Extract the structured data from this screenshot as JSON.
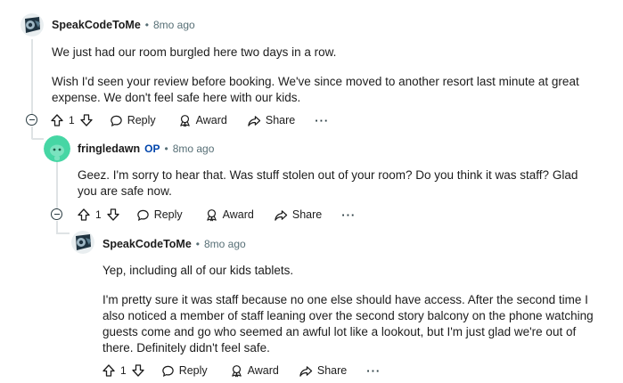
{
  "comments": [
    {
      "author": "SpeakCodeToMe",
      "separator": "•",
      "time": "8mo ago",
      "paragraphs": [
        "We just had our room burgled here two days in a row.",
        "Wish I'd seen your review before booking. We've since moved to another resort last minute at great expense. We don't feel safe here with our kids."
      ],
      "votes": "1",
      "reply_label": "Reply",
      "award_label": "Award",
      "share_label": "Share",
      "more_label": "···"
    },
    {
      "author": "fringledawn",
      "op_badge": "OP",
      "separator": "•",
      "time": "8mo ago",
      "paragraphs": [
        "Geez. I'm sorry to hear that. Was stuff stolen out of your room? Do you think it was staff? Glad you are safe now."
      ],
      "votes": "1",
      "reply_label": "Reply",
      "award_label": "Award",
      "share_label": "Share",
      "more_label": "···"
    },
    {
      "author": "SpeakCodeToMe",
      "separator": "•",
      "time": "8mo ago",
      "paragraphs": [
        "Yep, including all of our kids tablets.",
        "I'm pretty sure it was staff because no one else should have access. After the second time I also noticed a member of staff leaning over the second story balcony on the phone watching guests come and go who seemed an awful lot like a lookout, but I'm just glad we're out of there. Definitely didn't feel safe."
      ],
      "votes": "1",
      "reply_label": "Reply",
      "award_label": "Award",
      "share_label": "Share",
      "more_label": "···"
    }
  ],
  "icons": {
    "upvote": "arrow-up-outline",
    "downvote": "arrow-down-outline",
    "reply": "speech-bubble",
    "award": "award-ribbon",
    "share": "share-arrow",
    "collapse": "minus-circle"
  },
  "colors": {
    "op_badge": "#0045ac",
    "meta": "#576f76",
    "thread_line": "#dfe3e5",
    "avatar_teal": "#46d6a4"
  }
}
